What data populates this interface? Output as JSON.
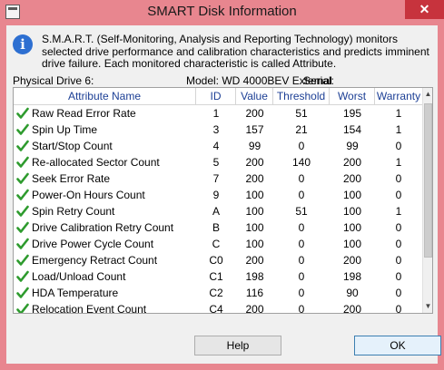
{
  "window": {
    "title": "SMART Disk Information",
    "close_glyph": "✕"
  },
  "info": {
    "icon": "info-icon",
    "glyph": "i",
    "text": "S.M.A.R.T. (Self-Monitoring, Analysis and Reporting Technology) monitors selected drive performance and calibration characteristics and predicts imminent drive failure. Each monitored characteristic is called Attribute."
  },
  "drive": {
    "label": "Physical Drive 6:",
    "model": "Model: WD 4000BEV External",
    "serial": "Serial:"
  },
  "table": {
    "headers": {
      "name": "Attribute Name",
      "id": "ID",
      "value": "Value",
      "threshold": "Threshold",
      "worst": "Worst",
      "warranty": "Warranty"
    },
    "rows": [
      {
        "name": "Raw Read Error Rate",
        "id": "1",
        "value": "200",
        "threshold": "51",
        "worst": "195",
        "warranty": "1"
      },
      {
        "name": "Spin Up Time",
        "id": "3",
        "value": "157",
        "threshold": "21",
        "worst": "154",
        "warranty": "1"
      },
      {
        "name": "Start/Stop Count",
        "id": "4",
        "value": "99",
        "threshold": "0",
        "worst": "99",
        "warranty": "0"
      },
      {
        "name": "Re-allocated Sector Count",
        "id": "5",
        "value": "200",
        "threshold": "140",
        "worst": "200",
        "warranty": "1"
      },
      {
        "name": "Seek Error Rate",
        "id": "7",
        "value": "200",
        "threshold": "0",
        "worst": "200",
        "warranty": "0"
      },
      {
        "name": "Power-On Hours Count",
        "id": "9",
        "value": "100",
        "threshold": "0",
        "worst": "100",
        "warranty": "0"
      },
      {
        "name": "Spin Retry Count",
        "id": "A",
        "value": "100",
        "threshold": "51",
        "worst": "100",
        "warranty": "1"
      },
      {
        "name": "Drive Calibration Retry Count",
        "id": "B",
        "value": "100",
        "threshold": "0",
        "worst": "100",
        "warranty": "0"
      },
      {
        "name": "Drive Power Cycle Count",
        "id": "C",
        "value": "100",
        "threshold": "0",
        "worst": "100",
        "warranty": "0"
      },
      {
        "name": "Emergency Retract Count",
        "id": "C0",
        "value": "200",
        "threshold": "0",
        "worst": "200",
        "warranty": "0"
      },
      {
        "name": "Load/Unload Count",
        "id": "C1",
        "value": "198",
        "threshold": "0",
        "worst": "198",
        "warranty": "0"
      },
      {
        "name": "HDA Temperature",
        "id": "C2",
        "value": "116",
        "threshold": "0",
        "worst": "90",
        "warranty": "0"
      },
      {
        "name": "Relocation Event Count",
        "id": "C4",
        "value": "200",
        "threshold": "0",
        "worst": "200",
        "warranty": "0"
      }
    ],
    "status_icon": "green-check-icon"
  },
  "scrollbar": {
    "up_glyph": "▲",
    "down_glyph": "▼"
  },
  "buttons": {
    "help": "Help",
    "ok": "OK"
  },
  "colors": {
    "titlebar": "#e8868f",
    "close": "#c7333d",
    "header_text": "#1c3f95",
    "check": "#2e9b2e"
  }
}
